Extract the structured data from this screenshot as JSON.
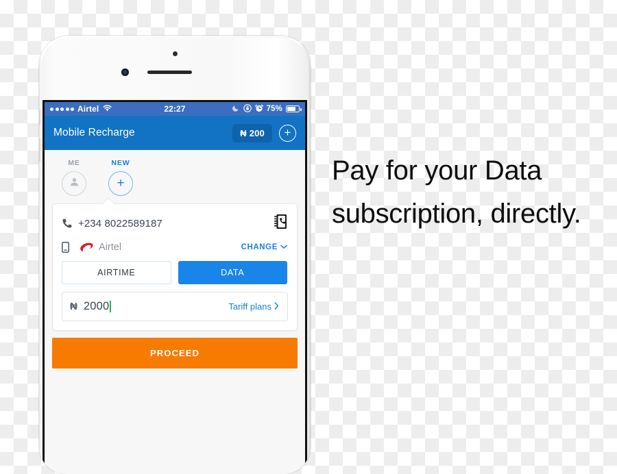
{
  "marketing": {
    "headline": "Pay for your Data subscription, directly."
  },
  "device": {
    "type": "white-smartphone"
  },
  "status_bar": {
    "signal_dots": 5,
    "carrier": "Airtel",
    "wifi_icon": "wifi-icon",
    "time": "22:27",
    "do_not_disturb_icon": "moon-icon",
    "rotation_lock_icon": "rotation-lock-icon",
    "alarm_icon": "alarm-clock-icon",
    "battery_percent": "75%",
    "battery_level": 75
  },
  "app_bar": {
    "title": "Mobile Recharge",
    "balance": "₦ 200",
    "add_label": "+"
  },
  "tabs": [
    {
      "label": "ME",
      "icon": "person-icon",
      "active": false
    },
    {
      "label": "NEW",
      "icon": "plus-icon",
      "active": true
    }
  ],
  "recharge_form": {
    "phone_icon": "phone-handset-icon",
    "phone_number": "+234 8022589187",
    "contacts_icon": "contact-book-icon",
    "sim_icon": "sim-card-icon",
    "operator_logo": "airtel-logo-icon",
    "operator_name": "Airtel",
    "change_label": "CHANGE",
    "change_chevron": "chevron-down-icon",
    "segments": [
      {
        "label": "AIRTIME",
        "active": false
      },
      {
        "label": "DATA",
        "active": true
      }
    ],
    "currency_symbol": "₦",
    "amount": "2000",
    "tariff_label": "Tariff plans",
    "tariff_chevron": "chevron-right-icon"
  },
  "actions": {
    "proceed_label": "PROCEED"
  },
  "colors": {
    "status_bar_blue": "#3b6ec1",
    "app_bar_blue": "#1273c4",
    "balance_badge_blue": "#0f63ab",
    "accent_blue": "#1a7fe0",
    "segment_active_blue": "#1a85e8",
    "proceed_orange": "#f77b00",
    "airtel_red": "#e01c22",
    "screen_background": "#f7f7f7"
  }
}
